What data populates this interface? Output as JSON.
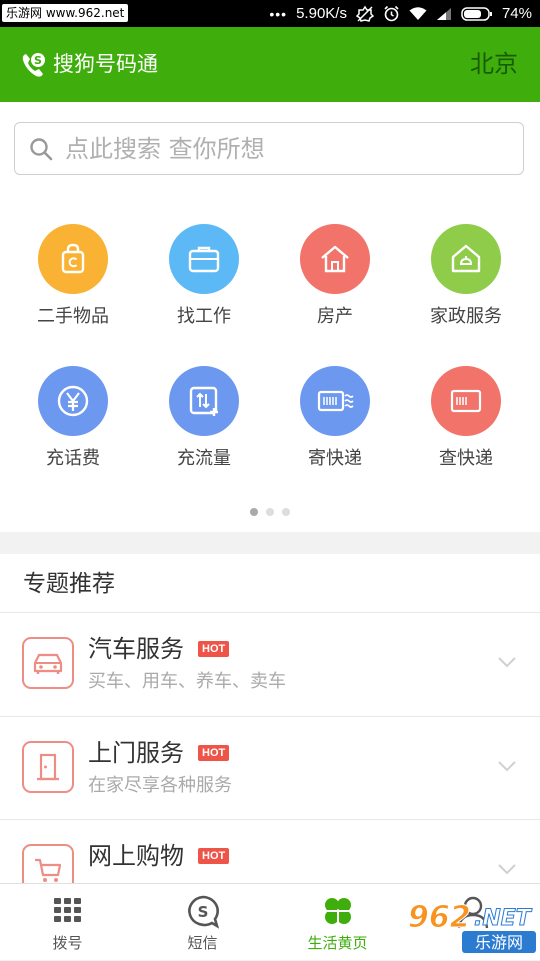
{
  "status_bar": {
    "watermark_text": "乐游网 www.962.net",
    "network_speed": "5.90K/s",
    "battery": "74%"
  },
  "header": {
    "app_title": "搜狗号码通",
    "city": "北京",
    "accent_color": "#3fae0c"
  },
  "search": {
    "placeholder": "点此搜索 查你所想"
  },
  "categories": [
    {
      "label": "二手物品",
      "icon": "shopping-bag-icon",
      "color": "#f9b233"
    },
    {
      "label": "找工作",
      "icon": "briefcase-icon",
      "color": "#5db9f5"
    },
    {
      "label": "房产",
      "icon": "house-icon",
      "color": "#f1736a"
    },
    {
      "label": "家政服务",
      "icon": "home-service-icon",
      "color": "#8fcc4a"
    },
    {
      "label": "充话费",
      "icon": "yen-icon",
      "color": "#6d98f0"
    },
    {
      "label": "充流量",
      "icon": "data-transfer-icon",
      "color": "#6d98f0"
    },
    {
      "label": "寄快递",
      "icon": "send-parcel-icon",
      "color": "#6d98f0"
    },
    {
      "label": "查快递",
      "icon": "track-parcel-icon",
      "color": "#f1736a"
    }
  ],
  "pager": {
    "count": 3,
    "active": 0
  },
  "topics": {
    "section_title": "专题推荐",
    "items": [
      {
        "title": "汽车服务",
        "badge": "HOT",
        "subtitle": "买车、用车、养车、卖车",
        "icon": "car-icon"
      },
      {
        "title": "上门服务",
        "badge": "HOT",
        "subtitle": "在家尽享各种服务",
        "icon": "door-icon"
      },
      {
        "title": "网上购物",
        "badge": "HOT",
        "subtitle": "",
        "icon": "cart-icon"
      }
    ]
  },
  "bottom_nav": [
    {
      "label": "拨号",
      "icon": "dialpad-icon",
      "active": false
    },
    {
      "label": "短信",
      "icon": "sms-icon",
      "active": false
    },
    {
      "label": "生活黄页",
      "icon": "clover-icon",
      "active": true
    },
    {
      "label": "",
      "icon": "profile-icon",
      "active": false
    }
  ],
  "corner_watermark": {
    "text_top": "962.NET",
    "text_bottom": "乐游网"
  }
}
